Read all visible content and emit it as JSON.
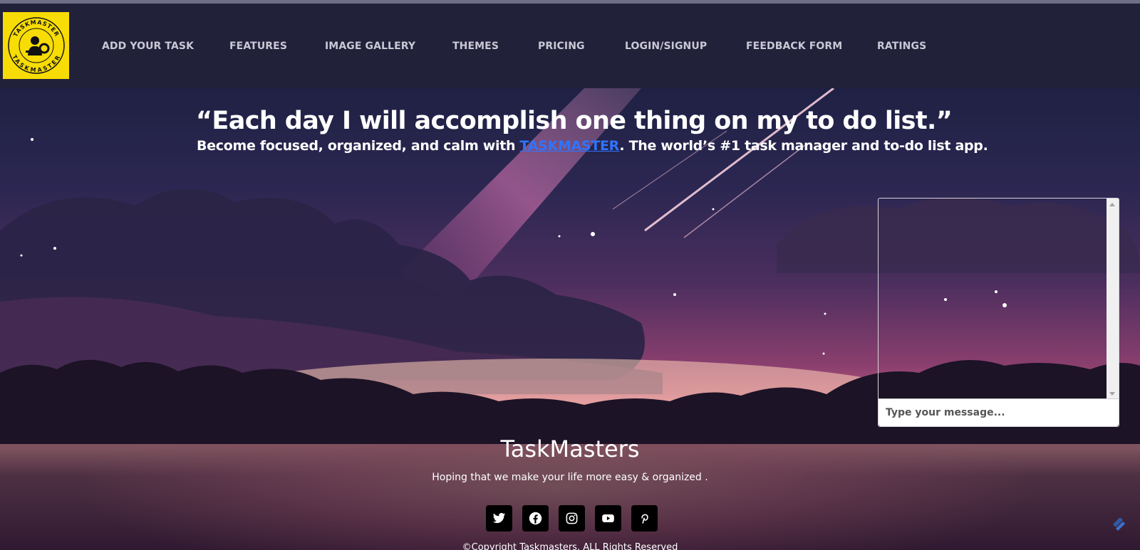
{
  "brand": {
    "logo_text": "TASKMASTER"
  },
  "nav": {
    "items": [
      {
        "label": "ADD YOUR TASK"
      },
      {
        "label": "FEATURES"
      },
      {
        "label": "IMAGE GALLERY"
      },
      {
        "label": "THEMES"
      },
      {
        "label": "PRICING"
      },
      {
        "label": "LOGIN/SIGNUP"
      },
      {
        "label": "FEEDBACK FORM"
      },
      {
        "label": "RATINGS"
      }
    ]
  },
  "hero": {
    "quote": "“Each day I will accomplish one thing on my to do list.”",
    "sub_before": "Become focused, organized, and calm with ",
    "sub_link": "TASKMASTER",
    "sub_after": ". The world’s #1 task manager and to-do list app."
  },
  "chat": {
    "placeholder": "Type your message..."
  },
  "footer": {
    "title": "TaskMasters",
    "tagline": "Hoping that we make your life more easy & organized .",
    "copyright": "©Copyright Taskmasters. ALL Rights Reserved",
    "socials": [
      "twitter-icon",
      "facebook-icon",
      "instagram-icon",
      "youtube-icon",
      "pinterest-icon"
    ]
  },
  "colors": {
    "nav_bg": "#22213a",
    "logo_bg": "#f7dc05",
    "link": "#2f74ff"
  }
}
